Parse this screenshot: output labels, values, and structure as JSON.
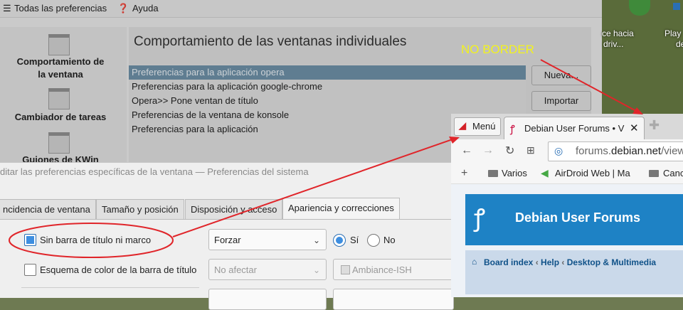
{
  "background_window": {
    "toolbar": {
      "all_prefs": "Todas las preferencias",
      "help": "Ayuda"
    },
    "sidebar": [
      {
        "label_line1": "Comportamiento de",
        "label_line2": "la ventana"
      },
      {
        "label_line1": "Cambiador de tareas",
        "label_line2": ""
      },
      {
        "label_line1": "Guiones de KWin",
        "label_line2": ""
      }
    ],
    "title": "Comportamiento de las ventanas individuales",
    "rules": [
      "Preferencias para la aplicación opera",
      "Preferencias para la aplicación google-chrome",
      "Opera>> Pone ventan de título",
      "Preferencias de la ventana de konsole",
      "Preferencias para la aplicación"
    ],
    "buttons": {
      "new": "Nueva...",
      "import": "Importar"
    }
  },
  "annotation": {
    "text": "NO BORDER",
    "color": "#f2f21e",
    "arrow_color": "#e0252a"
  },
  "desktop": {
    "icon1": [
      "ce hacia",
      "driv..."
    ],
    "icon2": [
      "Play",
      "de"
    ]
  },
  "dialog": {
    "title": "ditar las preferencias específicas de la ventana — Preferencias del sistema",
    "tabs": [
      "ncidencia de ventana",
      "Tamaño y posición",
      "Disposición y acceso",
      "Apariencia y correcciones"
    ],
    "row1": {
      "label": "Sin barra de título ni marco",
      "combo": "Forzar",
      "yes": "Sí",
      "no": "No"
    },
    "row2": {
      "label": "Esquema de color de la barra de título",
      "combo": "No afectar",
      "theme": "Ambiance-ISH"
    }
  },
  "browser": {
    "menu": "Menú",
    "tab_title": "Debian User Forums • V",
    "url": {
      "prefix": "forums.",
      "domain": "debian.net",
      "suffix": "/view"
    },
    "bookmarks": [
      "Varios",
      "AirDroid Web | Ma",
      "Canc"
    ],
    "site_title": "Debian User Forums",
    "breadcrumb": [
      "Board index",
      "Help",
      "Desktop & Multimedia"
    ],
    "accent": "#1e82c5"
  }
}
